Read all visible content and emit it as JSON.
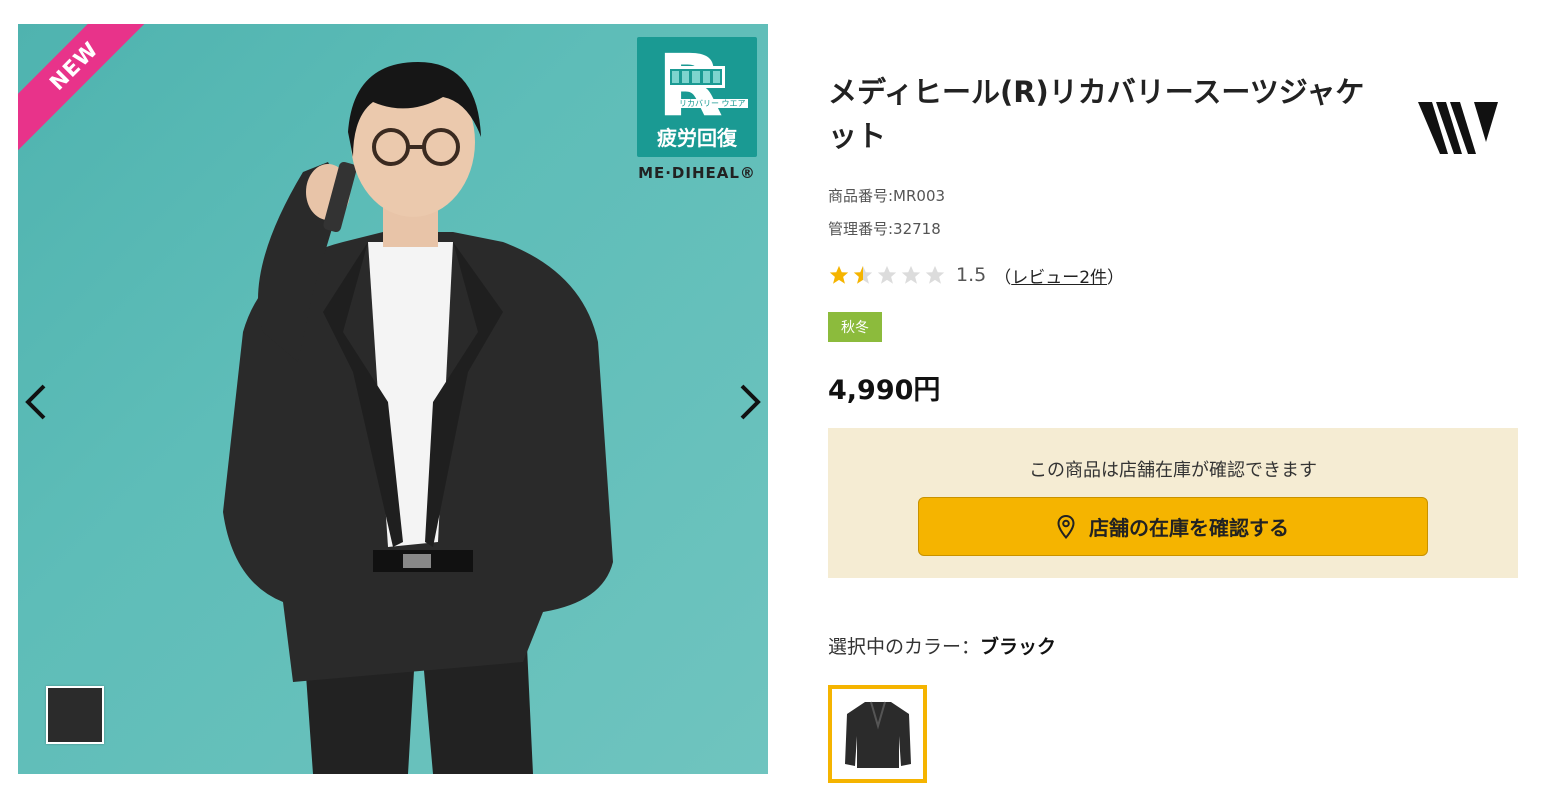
{
  "gallery": {
    "ribbon": "NEW",
    "badge_small": "リカバリー ウエア",
    "badge_main": "疲労回復",
    "badge_brand": "ME·DIHEAL®",
    "prev_icon": "chevron-left-icon",
    "next_icon": "chevron-right-icon"
  },
  "product": {
    "title": "メディヒール(R)リカバリースーツジャケット",
    "product_number": "商品番号:MR003",
    "management_number": "管理番号:32718",
    "rating": 1.5,
    "rating_text": "1.5",
    "review_open": "（",
    "review_link": "レビュー2件",
    "review_close": "）",
    "season": "秋冬",
    "price": "4,990円"
  },
  "store": {
    "message": "この商品は店舗在庫が確認できます",
    "button_label": "店舗の在庫を確認する",
    "button_icon": "map-pin-icon"
  },
  "color": {
    "label": "選択中のカラー：",
    "selected": "ブラック"
  },
  "colors": {
    "ribbon": "#e8338a",
    "star": "#f5b400",
    "season": "#8cbb3c",
    "store_bg": "#f5ecd3",
    "button": "#f5b400",
    "background": "#5ebdb8"
  }
}
